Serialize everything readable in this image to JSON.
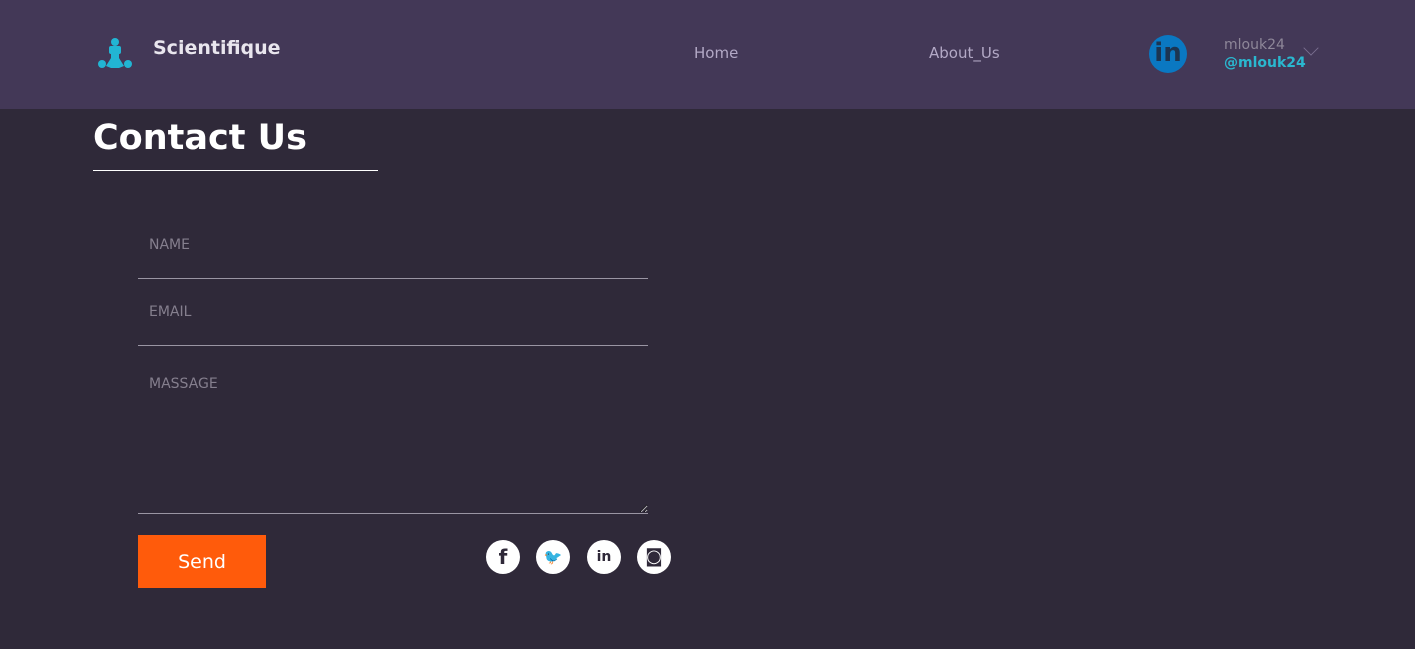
{
  "header": {
    "brand": "Scientifique",
    "nav": [
      {
        "label": "Home"
      },
      {
        "label": "About_Us"
      }
    ],
    "user": {
      "name": "mlouk24",
      "handle": "@mlouk24",
      "avatar_glyph": "in"
    }
  },
  "main": {
    "title": "Contact Us",
    "form": {
      "name_placeholder": "NAME",
      "email_placeholder": "EMAIL",
      "message_placeholder": "MASSAGE",
      "send_label": "Send"
    },
    "social": [
      {
        "icon": "facebook-icon",
        "glyph": "f"
      },
      {
        "icon": "twitter-icon",
        "glyph": "🐦"
      },
      {
        "icon": "linkedin-icon",
        "glyph": "in"
      },
      {
        "icon": "instagram-icon",
        "glyph": "◙"
      }
    ]
  },
  "colors": {
    "header": "#433857",
    "background": "#2f2939",
    "accent": "#ff5b0b",
    "teal": "#2ab7cf"
  }
}
